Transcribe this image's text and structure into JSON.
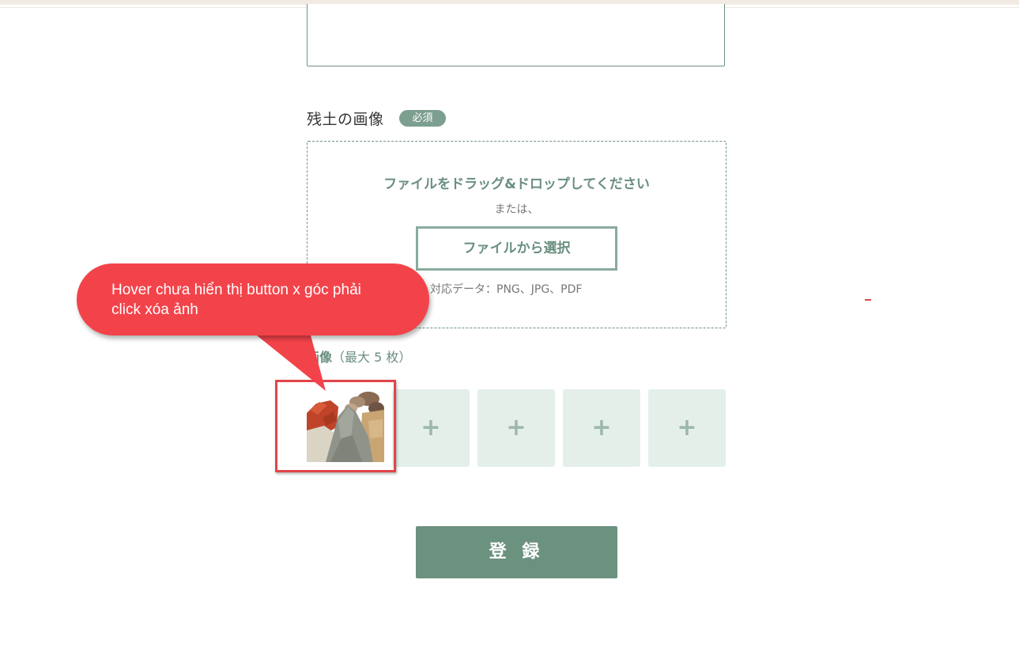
{
  "upload_section": {
    "label": "残土の画像",
    "required_badge": "必須",
    "drop_title": "ファイルをドラッグ&ドロップしてください",
    "drop_or": "または、",
    "select_button": "ファイルから選択",
    "formats": "対応データ：PNG、JPG、PDF"
  },
  "images": {
    "label_main": "画像",
    "label_note": "（最大 5 枚）",
    "empty_slot_symbol": "+"
  },
  "submit_button": "登 録",
  "annotation": {
    "line1": "Hover chưa hiển thị button x góc phải",
    "line2": "click xóa ảnh",
    "color": "#f3434a"
  },
  "colors": {
    "accent_green": "#6b917f",
    "slot_bg": "#e4efe9"
  }
}
